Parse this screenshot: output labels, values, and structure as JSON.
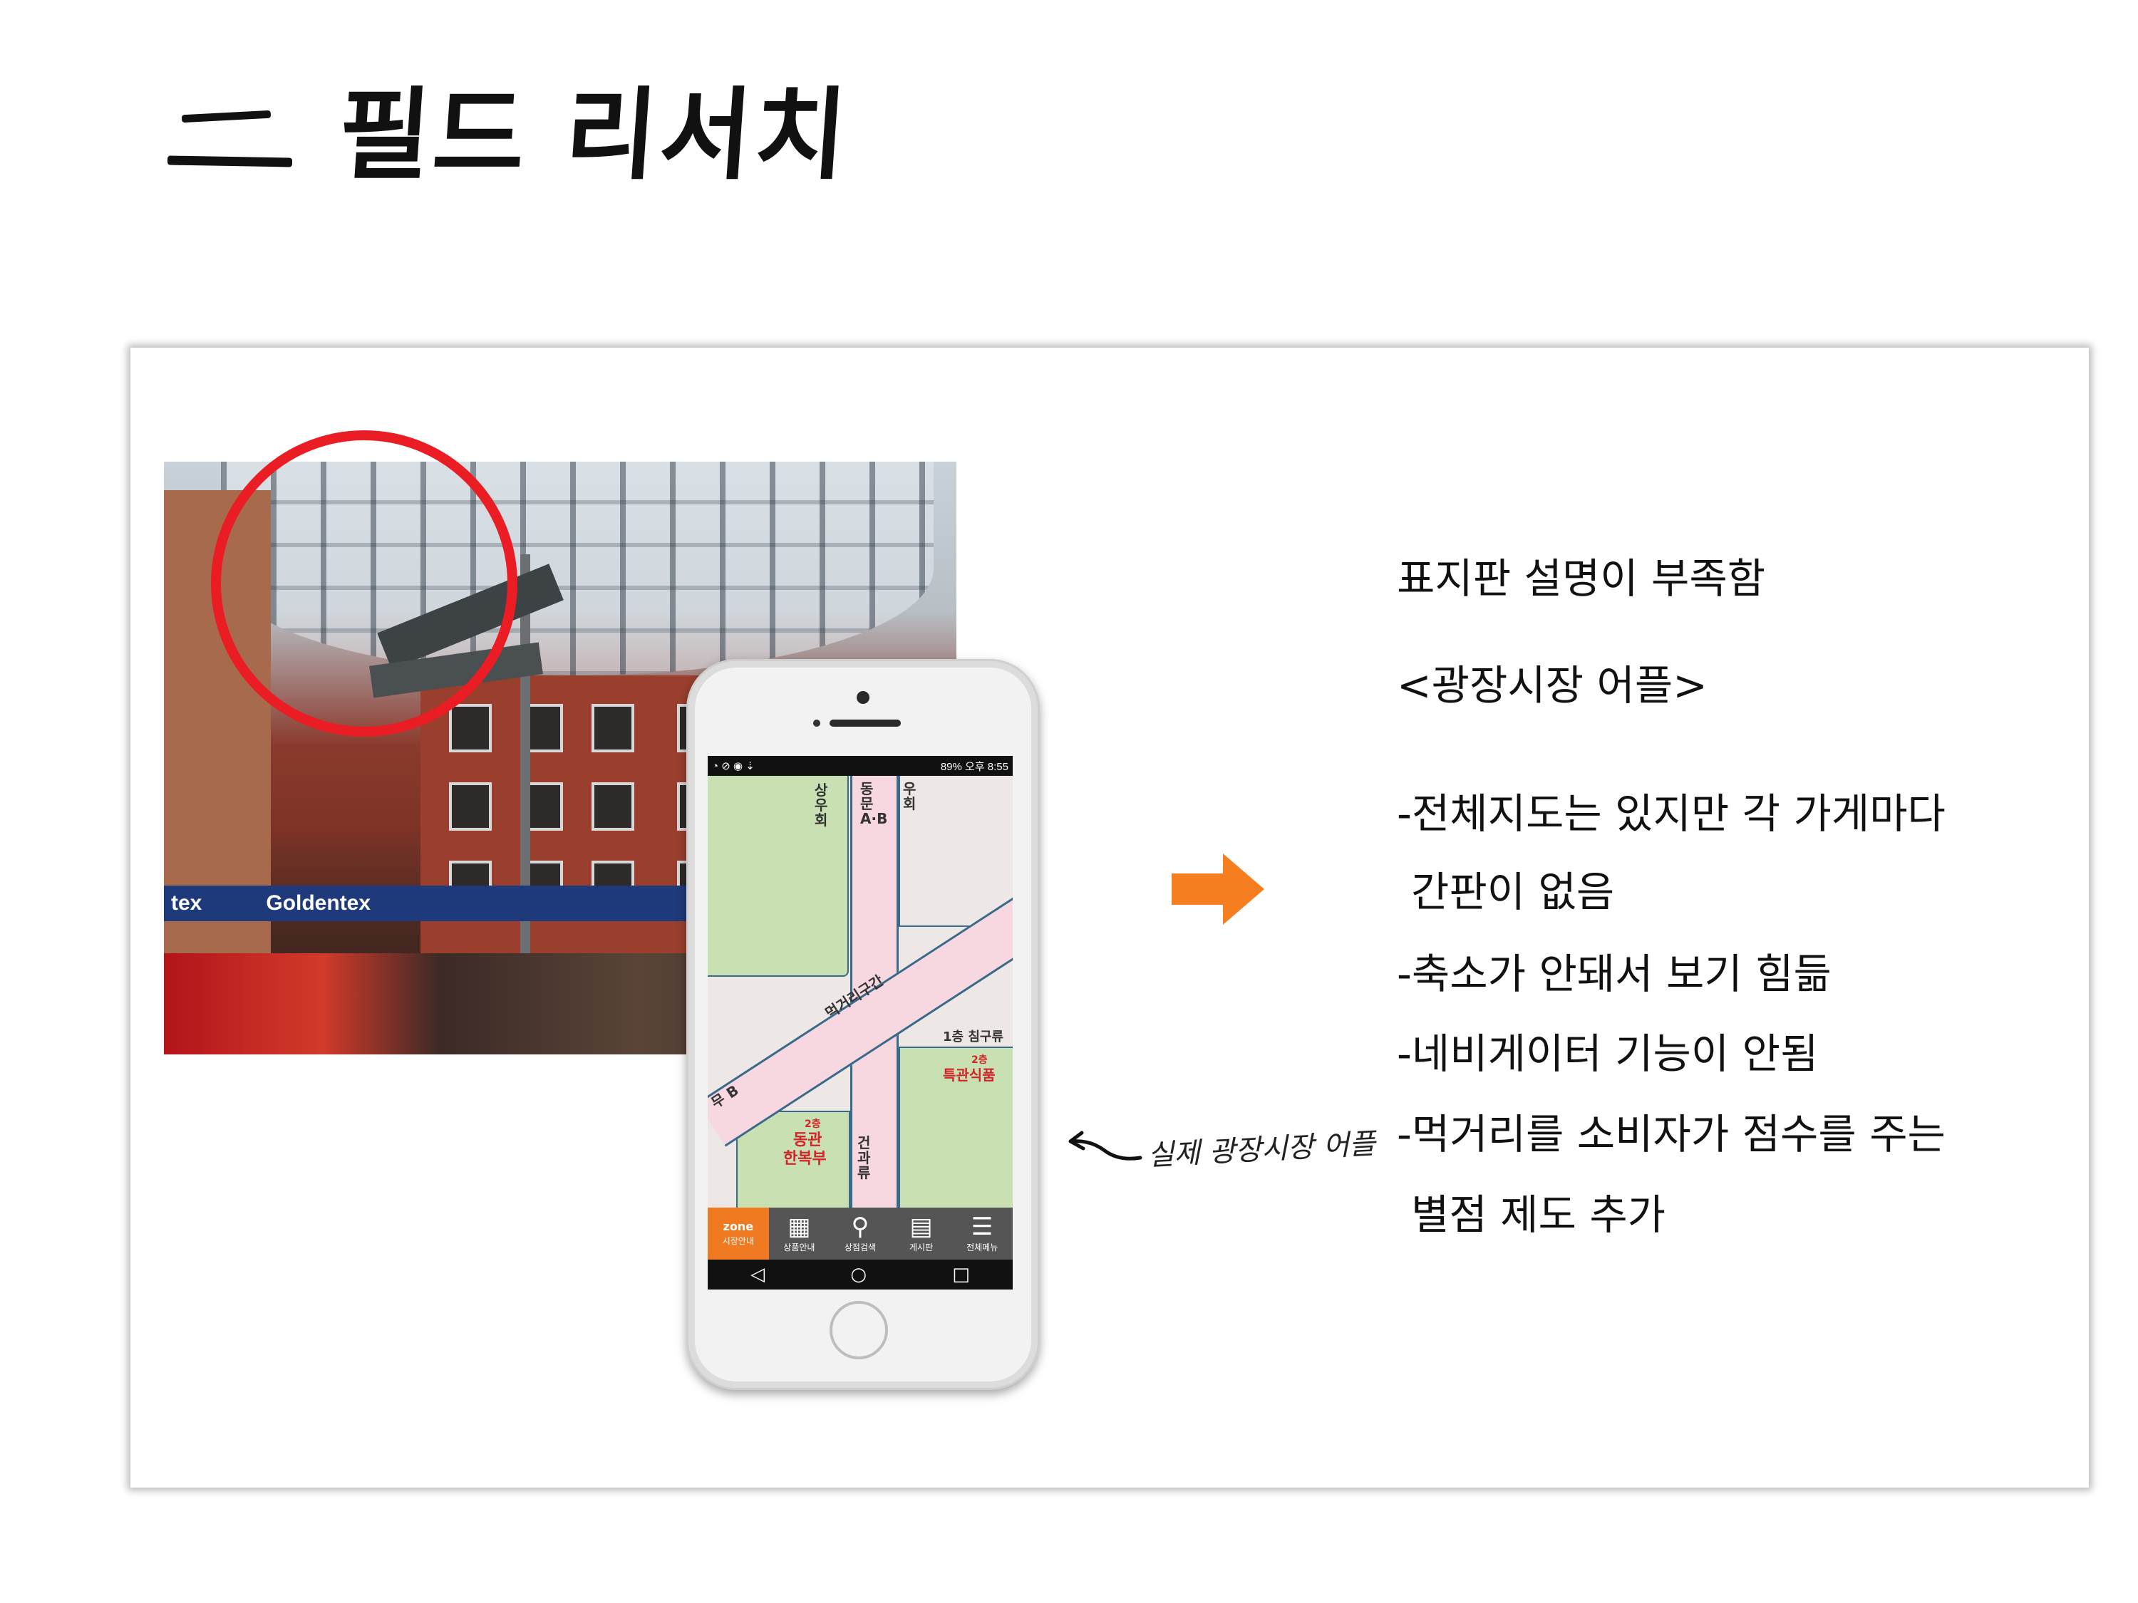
{
  "title": "필드 리서치",
  "photo": {
    "banner_words": [
      "tex",
      "Goldentex"
    ]
  },
  "phone": {
    "status_left": "◔ ⊘ ◉ ⇣",
    "status_right": "89% 오후 8:55",
    "map_labels": {
      "label1": "상우회",
      "label2": "동문 A·B",
      "label3": "우회",
      "label4": "먹거리구간",
      "label5": "1층 침구류",
      "label6": "2층",
      "label7": "특관식품",
      "label8": "2층",
      "label9": "동관",
      "label10": "한복부",
      "label11": "건과류",
      "label12": "무 B"
    },
    "tabs": [
      {
        "label": "시장안내",
        "icon": "market-zone-icon",
        "glyph": "zone"
      },
      {
        "label": "상품안내",
        "icon": "grid-icon",
        "glyph": "▦"
      },
      {
        "label": "상점검색",
        "icon": "search-icon",
        "glyph": "⚲"
      },
      {
        "label": "게시판",
        "icon": "document-icon",
        "glyph": "▤"
      },
      {
        "label": "전체메뉴",
        "icon": "menu-icon",
        "glyph": "☰"
      }
    ],
    "nav": {
      "back": "◁",
      "home": "○",
      "recent": "□"
    }
  },
  "annotation": "실제 광장시장 어플",
  "description": {
    "heading": "표지판 설명이 부족함",
    "app_label": "<광장시장 어플>",
    "point1_line1": "-전체지도는 있지만 각 가게마다",
    "point1_line2": "간판이 없음",
    "point2": "-축소가 안돼서 보기 힘듦",
    "point3": "-네비게이터 기능이 안됨",
    "point4_line1": "-먹거리를 소비자가 점수를 주는",
    "point4_line2": "별점 제도 추가"
  },
  "colors": {
    "highlight_circle": "#ea1c24",
    "arrow": "#f57f20",
    "app_accent": "#f07a21"
  }
}
